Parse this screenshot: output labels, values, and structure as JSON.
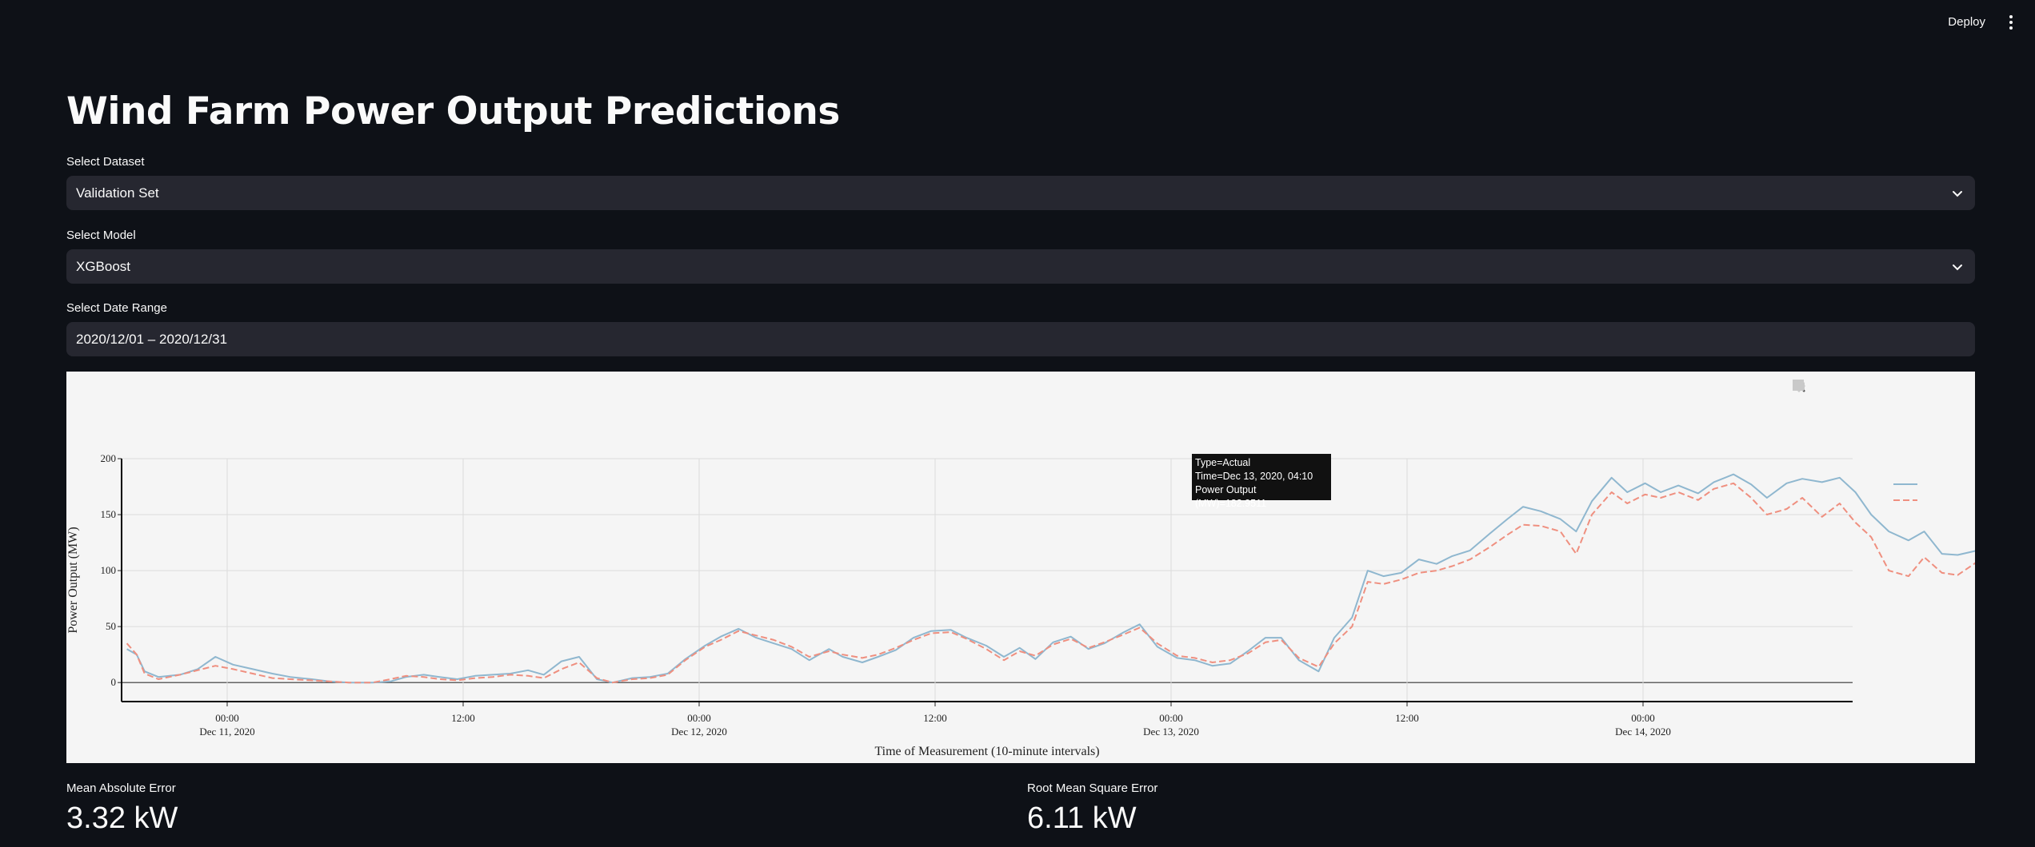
{
  "header": {
    "deploy_label": "Deploy",
    "menu_icon": "kebab-menu-icon"
  },
  "page": {
    "title": "Wind Farm Power Output Predictions"
  },
  "controls": {
    "dataset": {
      "label": "Select Dataset",
      "value": "Validation Set"
    },
    "model": {
      "label": "Select Model",
      "value": "XGBoost"
    },
    "date_range": {
      "label": "Select Date Range",
      "value": "2020/12/01 – 2020/12/31"
    }
  },
  "tooltip": {
    "type": "Type=Actual",
    "time": "Time=Dec 13, 2020, 04:10",
    "power": "Power Output (MW)=182.9511"
  },
  "metrics": {
    "mae": {
      "label": "Mean Absolute Error",
      "value": "3.32 kW"
    },
    "rmse": {
      "label": "Root Mean Square Error",
      "value": "6.11 kW"
    }
  },
  "colors": {
    "actual": "#8fb7cf",
    "predicted": "#ef8f7f",
    "panel": "#f5f5f5"
  },
  "chart_data": {
    "type": "line",
    "xlabel": "Time of Measurement (10-minute intervals)",
    "ylabel": "Power Output (MW)",
    "ylim": [
      -17,
      200
    ],
    "yticks": [
      0,
      50,
      100,
      150,
      200
    ],
    "xrange_hours": [
      -13.5,
      60.0
    ],
    "xtick_labels": [
      {
        "h": 0,
        "line1": "00:00",
        "line2": "Dec 11, 2020"
      },
      {
        "h": 12,
        "line1": "12:00",
        "line2": ""
      },
      {
        "h": 24,
        "line1": "00:00",
        "line2": "Dec 12, 2020"
      },
      {
        "h": 36,
        "line1": "12:00",
        "line2": ""
      },
      {
        "h": 48,
        "line1": "00:00",
        "line2": "Dec 13, 2020"
      },
      {
        "h": 60,
        "line1": "12:00",
        "line2": ""
      },
      {
        "h": 72,
        "line1": "00:00",
        "line2": "Dec 14, 2020"
      }
    ],
    "grid": true,
    "legend": "top-right",
    "series": [
      {
        "key": "actual",
        "style": "solid",
        "points": [
          [
            -5.1,
            30
          ],
          [
            -4.6,
            25
          ],
          [
            -4.2,
            10
          ],
          [
            -3.5,
            5
          ],
          [
            -2.4,
            7
          ],
          [
            -1.5,
            12
          ],
          [
            -0.6,
            23
          ],
          [
            0.3,
            16
          ],
          [
            1.3,
            12
          ],
          [
            2.3,
            8
          ],
          [
            3.2,
            5
          ],
          [
            4.3,
            3
          ],
          [
            5.2,
            1
          ],
          [
            6.2,
            0
          ],
          [
            7.4,
            0
          ],
          [
            8.3,
            1
          ],
          [
            9.1,
            5
          ],
          [
            10.0,
            7
          ],
          [
            10.8,
            5
          ],
          [
            11.7,
            3
          ],
          [
            12.6,
            6
          ],
          [
            13.5,
            7
          ],
          [
            14.4,
            8
          ],
          [
            15.3,
            11
          ],
          [
            16.1,
            7
          ],
          [
            17.0,
            19
          ],
          [
            17.9,
            23
          ],
          [
            18.8,
            3
          ],
          [
            19.6,
            0
          ],
          [
            20.6,
            4
          ],
          [
            21.5,
            5
          ],
          [
            22.4,
            8
          ],
          [
            23.3,
            21
          ],
          [
            24.3,
            33
          ],
          [
            25.1,
            41
          ],
          [
            26.0,
            48
          ],
          [
            26.9,
            40
          ],
          [
            27.8,
            35
          ],
          [
            28.7,
            30
          ],
          [
            29.6,
            20
          ],
          [
            30.6,
            30
          ],
          [
            31.3,
            23
          ],
          [
            32.3,
            18
          ],
          [
            33.1,
            23
          ],
          [
            34.0,
            29
          ],
          [
            34.9,
            40
          ],
          [
            35.8,
            46
          ],
          [
            36.8,
            47
          ],
          [
            37.6,
            40
          ],
          [
            38.6,
            33
          ],
          [
            39.5,
            23
          ],
          [
            40.3,
            31
          ],
          [
            41.1,
            21
          ],
          [
            42.0,
            36
          ],
          [
            42.9,
            41
          ],
          [
            43.8,
            30
          ],
          [
            44.6,
            35
          ],
          [
            45.6,
            45
          ],
          [
            46.4,
            52
          ],
          [
            47.3,
            32
          ],
          [
            48.3,
            22
          ],
          [
            49.2,
            20
          ],
          [
            50.1,
            15
          ],
          [
            51.0,
            17
          ],
          [
            51.9,
            28
          ],
          [
            52.8,
            40
          ],
          [
            53.6,
            40
          ],
          [
            54.5,
            20
          ],
          [
            55.5,
            10
          ],
          [
            56.3,
            40
          ],
          [
            57.2,
            58
          ],
          [
            58.0,
            100
          ],
          [
            58.8,
            95
          ],
          [
            59.7,
            98
          ],
          [
            60.6,
            110
          ],
          [
            61.5,
            106
          ],
          [
            62.3,
            113
          ],
          [
            63.2,
            118
          ],
          [
            64.2,
            133
          ],
          [
            65.1,
            146
          ],
          [
            65.9,
            157
          ],
          [
            66.8,
            153
          ],
          [
            67.8,
            146
          ],
          [
            68.6,
            135
          ],
          [
            69.4,
            162
          ],
          [
            70.4,
            183
          ],
          [
            71.2,
            170
          ],
          [
            72.1,
            178
          ],
          [
            72.9,
            170
          ],
          [
            73.8,
            176
          ],
          [
            74.8,
            169
          ],
          [
            75.6,
            179
          ],
          [
            76.6,
            186
          ],
          [
            77.5,
            177
          ],
          [
            78.3,
            165
          ],
          [
            79.3,
            178
          ],
          [
            80.1,
            182
          ],
          [
            81.1,
            179
          ],
          [
            82.0,
            183
          ],
          [
            82.8,
            170
          ],
          [
            83.6,
            150
          ],
          [
            84.5,
            135
          ],
          [
            85.5,
            127
          ],
          [
            86.3,
            135
          ],
          [
            87.2,
            115
          ],
          [
            88.0,
            114
          ],
          [
            89.0,
            118
          ],
          [
            89.8,
            112
          ],
          [
            90.6,
            120
          ],
          [
            91.5,
            80
          ],
          [
            92.5,
            86
          ],
          [
            93.3,
            89
          ],
          [
            94.1,
            102
          ],
          [
            95.0,
            75
          ],
          [
            95.9,
            52
          ],
          [
            96.8,
            40
          ],
          [
            97.7,
            39
          ],
          [
            98.6,
            32
          ],
          [
            99.5,
            30
          ],
          [
            100.4,
            22
          ],
          [
            101.3,
            19
          ],
          [
            102.3,
            16
          ],
          [
            103.1,
            21
          ],
          [
            104.0,
            36
          ],
          [
            104.9,
            35
          ],
          [
            105.8,
            31
          ],
          [
            106.7,
            40
          ],
          [
            107.5,
            44
          ],
          [
            108.4,
            60
          ],
          [
            109.3,
            44
          ],
          [
            110.3,
            36
          ],
          [
            111.1,
            28
          ],
          [
            112.0,
            24
          ],
          [
            112.9,
            22
          ],
          [
            113.8,
            21
          ],
          [
            114.7,
            18
          ],
          [
            115.6,
            19
          ],
          [
            116.4,
            25
          ],
          [
            117.3,
            22
          ],
          [
            118.2,
            21
          ],
          [
            119.1,
            10
          ],
          [
            120.0,
            14
          ],
          [
            120.8,
            9
          ],
          [
            121.7,
            3
          ],
          [
            122.6,
            7
          ],
          [
            123.5,
            6
          ],
          [
            124.3,
            11
          ],
          [
            125.3,
            7
          ],
          [
            126.3,
            0
          ]
        ]
      },
      {
        "key": "predicted",
        "style": "dash",
        "points": [
          [
            -5.1,
            35
          ],
          [
            -4.6,
            25
          ],
          [
            -4.2,
            8
          ],
          [
            -3.5,
            3
          ],
          [
            -2.4,
            7
          ],
          [
            -1.5,
            11
          ],
          [
            -0.6,
            15
          ],
          [
            0.3,
            12
          ],
          [
            1.3,
            8
          ],
          [
            2.3,
            4
          ],
          [
            3.2,
            3
          ],
          [
            4.3,
            2
          ],
          [
            5.2,
            1
          ],
          [
            6.2,
            0
          ],
          [
            7.4,
            0
          ],
          [
            8.3,
            3
          ],
          [
            9.1,
            6
          ],
          [
            10.0,
            5
          ],
          [
            10.8,
            3
          ],
          [
            11.7,
            2
          ],
          [
            12.6,
            4
          ],
          [
            13.5,
            5
          ],
          [
            14.4,
            7
          ],
          [
            15.3,
            6
          ],
          [
            16.1,
            4
          ],
          [
            17.0,
            12
          ],
          [
            17.9,
            18
          ],
          [
            18.8,
            4
          ],
          [
            19.6,
            0
          ],
          [
            20.6,
            3
          ],
          [
            21.5,
            4
          ],
          [
            22.4,
            7
          ],
          [
            23.3,
            20
          ],
          [
            24.3,
            32
          ],
          [
            25.1,
            38
          ],
          [
            26.0,
            46
          ],
          [
            26.9,
            42
          ],
          [
            27.8,
            38
          ],
          [
            28.7,
            32
          ],
          [
            29.6,
            23
          ],
          [
            30.6,
            28
          ],
          [
            31.3,
            25
          ],
          [
            32.3,
            22
          ],
          [
            33.1,
            25
          ],
          [
            34.0,
            31
          ],
          [
            34.9,
            38
          ],
          [
            35.8,
            44
          ],
          [
            36.8,
            45
          ],
          [
            37.6,
            39
          ],
          [
            38.6,
            30
          ],
          [
            39.5,
            20
          ],
          [
            40.3,
            28
          ],
          [
            41.1,
            24
          ],
          [
            42.0,
            34
          ],
          [
            42.9,
            39
          ],
          [
            43.8,
            31
          ],
          [
            44.6,
            36
          ],
          [
            45.6,
            43
          ],
          [
            46.4,
            49
          ],
          [
            47.3,
            35
          ],
          [
            48.3,
            24
          ],
          [
            49.2,
            22
          ],
          [
            50.1,
            18
          ],
          [
            51.0,
            20
          ],
          [
            51.9,
            26
          ],
          [
            52.8,
            36
          ],
          [
            53.6,
            38
          ],
          [
            54.5,
            22
          ],
          [
            55.5,
            14
          ],
          [
            56.3,
            35
          ],
          [
            57.2,
            50
          ],
          [
            58.0,
            90
          ],
          [
            58.8,
            88
          ],
          [
            59.7,
            92
          ],
          [
            60.6,
            98
          ],
          [
            61.5,
            100
          ],
          [
            62.3,
            104
          ],
          [
            63.2,
            110
          ],
          [
            64.2,
            121
          ],
          [
            65.1,
            132
          ],
          [
            65.9,
            141
          ],
          [
            66.8,
            140
          ],
          [
            67.8,
            135
          ],
          [
            68.6,
            115
          ],
          [
            69.4,
            150
          ],
          [
            70.4,
            170
          ],
          [
            71.2,
            160
          ],
          [
            72.1,
            168
          ],
          [
            72.9,
            165
          ],
          [
            73.8,
            170
          ],
          [
            74.8,
            163
          ],
          [
            75.6,
            173
          ],
          [
            76.6,
            178
          ],
          [
            77.5,
            165
          ],
          [
            78.3,
            150
          ],
          [
            79.3,
            155
          ],
          [
            80.1,
            165
          ],
          [
            81.1,
            148
          ],
          [
            82.0,
            160
          ],
          [
            82.8,
            143
          ],
          [
            83.6,
            130
          ],
          [
            84.5,
            100
          ],
          [
            85.5,
            95
          ],
          [
            86.3,
            112
          ],
          [
            87.2,
            98
          ],
          [
            88.0,
            96
          ],
          [
            89.0,
            108
          ],
          [
            89.8,
            103
          ],
          [
            90.6,
            110
          ],
          [
            91.5,
            70
          ],
          [
            92.5,
            75
          ],
          [
            93.3,
            78
          ],
          [
            94.1,
            85
          ],
          [
            95.0,
            65
          ],
          [
            95.9,
            50
          ],
          [
            96.8,
            40
          ],
          [
            97.7,
            38
          ],
          [
            98.6,
            33
          ],
          [
            99.5,
            30
          ],
          [
            100.4,
            28
          ],
          [
            101.3,
            26
          ],
          [
            102.3,
            22
          ],
          [
            103.1,
            24
          ],
          [
            104.0,
            30
          ],
          [
            104.9,
            33
          ],
          [
            105.8,
            30
          ],
          [
            106.7,
            36
          ],
          [
            107.5,
            38
          ],
          [
            108.4,
            47
          ],
          [
            109.3,
            40
          ],
          [
            110.3,
            33
          ],
          [
            111.1,
            22
          ],
          [
            112.0,
            19
          ],
          [
            112.9,
            16
          ],
          [
            113.8,
            15
          ],
          [
            114.7,
            14
          ],
          [
            115.6,
            16
          ],
          [
            116.4,
            18
          ],
          [
            117.3,
            20
          ],
          [
            118.2,
            18
          ],
          [
            119.1,
            12
          ],
          [
            120.0,
            11
          ],
          [
            120.8,
            8
          ],
          [
            121.7,
            5
          ],
          [
            122.6,
            8
          ],
          [
            123.5,
            4
          ],
          [
            124.3,
            9
          ],
          [
            125.3,
            5
          ],
          [
            126.3,
            0
          ]
        ]
      }
    ]
  }
}
